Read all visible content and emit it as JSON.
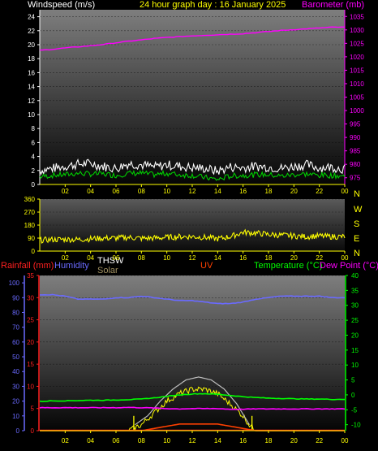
{
  "header": {
    "left_label": "Windspeed (m/s)",
    "title": "24 hour graph day : 16 January 2025",
    "right_label": "Barometer (mb)"
  },
  "colors": {
    "windspeed_axis": "#ffffff",
    "title": "#ffff00",
    "barometer": "#ff00ff",
    "wind_gust": "#ffffff",
    "wind_avg": "#00cc00",
    "wind_dir": "#ffff00",
    "rainfall": "#ff2020",
    "humidity": "#6a6aff",
    "thsw": "#ffffff",
    "solar": "#a09060",
    "uv": "#ff4000",
    "temperature": "#00ff00",
    "dew_point": "#ff00ff",
    "axis_grid_text": "#ffff00"
  },
  "chart_data": [
    {
      "type": "line",
      "xlabel": "",
      "x_ticks": [
        "02",
        "04",
        "06",
        "08",
        "10",
        "12",
        "14",
        "16",
        "18",
        "20",
        "22",
        "00"
      ],
      "left_axis": {
        "label": "Windspeed (m/s)",
        "ylim": [
          0,
          25
        ],
        "ticks": [
          0,
          2,
          4,
          6,
          8,
          10,
          12,
          14,
          16,
          18,
          20,
          22,
          24
        ]
      },
      "right_axis": {
        "label": "Barometer (mb)",
        "ylim": [
          972.5,
          1037.5
        ],
        "ticks": [
          975,
          980,
          985,
          990,
          995,
          1000,
          1005,
          1010,
          1015,
          1020,
          1025,
          1030,
          1035
        ]
      },
      "series": [
        {
          "name": "Barometer (mb)",
          "axis": "right",
          "x": [
            0,
            1,
            2,
            3,
            4,
            5,
            6,
            7,
            8,
            9,
            10,
            11,
            12,
            13,
            14,
            15,
            16,
            17,
            18,
            19,
            20,
            21,
            22,
            23,
            24
          ],
          "values": [
            1022.4,
            1022.8,
            1023.3,
            1023.7,
            1024.1,
            1024.6,
            1025.2,
            1025.8,
            1026.3,
            1026.8,
            1027.2,
            1027.5,
            1027.8,
            1028.0,
            1028.2,
            1028.4,
            1028.6,
            1029.0,
            1029.4,
            1029.8,
            1030.1,
            1030.4,
            1030.7,
            1031.0,
            1031.0
          ]
        },
        {
          "name": "Gust",
          "axis": "left",
          "x": [
            0,
            1,
            2,
            3,
            4,
            5,
            6,
            7,
            8,
            9,
            10,
            11,
            12,
            13,
            14,
            15,
            16,
            17,
            18,
            19,
            20,
            21,
            22,
            23,
            24
          ],
          "values": [
            2.0,
            2.3,
            2.6,
            2.9,
            3.0,
            2.6,
            2.3,
            3.0,
            2.8,
            2.5,
            2.8,
            2.6,
            2.4,
            2.3,
            1.9,
            2.5,
            2.4,
            2.6,
            2.5,
            2.3,
            2.6,
            2.8,
            2.4,
            2.5,
            2.2
          ]
        },
        {
          "name": "Average",
          "axis": "left",
          "x": [
            0,
            1,
            2,
            3,
            4,
            5,
            6,
            7,
            8,
            9,
            10,
            11,
            12,
            13,
            14,
            15,
            16,
            17,
            18,
            19,
            20,
            21,
            22,
            23,
            24
          ],
          "values": [
            1.1,
            1.3,
            1.4,
            1.6,
            1.5,
            1.5,
            1.3,
            1.6,
            1.6,
            1.4,
            1.6,
            1.4,
            1.3,
            1.0,
            0.7,
            1.2,
            1.3,
            1.4,
            1.4,
            1.2,
            1.4,
            1.5,
            1.3,
            1.3,
            1.2
          ]
        }
      ]
    },
    {
      "type": "line",
      "x_ticks": [
        "02",
        "04",
        "06",
        "08",
        "10",
        "12",
        "14",
        "16",
        "18",
        "20",
        "22",
        "00"
      ],
      "left_axis": {
        "label": "",
        "ylim": [
          0,
          360
        ],
        "ticks": [
          0,
          90,
          180,
          270,
          360
        ]
      },
      "right_axis": {
        "label": "",
        "ticks": [
          "N",
          "W",
          "S",
          "E",
          "N"
        ]
      },
      "series": [
        {
          "name": "Wind direction",
          "x": [
            0,
            1,
            2,
            3,
            4,
            5,
            6,
            7,
            8,
            9,
            10,
            11,
            12,
            13,
            14,
            15,
            16,
            17,
            18,
            19,
            20,
            21,
            22,
            23,
            24
          ],
          "values": [
            75,
            80,
            82,
            80,
            85,
            90,
            90,
            95,
            88,
            90,
            95,
            100,
            100,
            95,
            85,
            100,
            130,
            125,
            115,
            110,
            105,
            100,
            105,
            100,
            100
          ]
        }
      ]
    },
    {
      "type": "line",
      "x_ticks": [
        "02",
        "04",
        "06",
        "08",
        "10",
        "12",
        "14",
        "16",
        "18",
        "20",
        "22",
        "00"
      ],
      "labels": {
        "rainfall": "Rainfall (mm)",
        "humidity": "Humidity",
        "thsw": "THSW",
        "solar": "Solar",
        "uv": "UV",
        "temperature": "Temperature (°C)",
        "dew_point": "Dew Point (°C)"
      },
      "humidity_axis": {
        "ylim": [
          0,
          105
        ],
        "ticks": [
          0,
          10,
          20,
          30,
          40,
          50,
          60,
          70,
          80,
          90,
          100
        ]
      },
      "rain_axis": {
        "ylim": [
          0,
          35
        ],
        "ticks": [
          0,
          5,
          10,
          15,
          20,
          25,
          30,
          35
        ]
      },
      "temp_axis": {
        "ylim": [
          -12,
          40
        ],
        "ticks": [
          -10,
          -5,
          0,
          5,
          10,
          15,
          20,
          25,
          30,
          35,
          40
        ]
      },
      "series": [
        {
          "name": "Humidity",
          "axis": "humidity",
          "x": [
            0,
            1,
            2,
            3,
            4,
            5,
            6,
            7,
            8,
            9,
            10,
            11,
            12,
            13,
            14,
            15,
            16,
            17,
            18,
            19,
            20,
            21,
            22,
            23,
            24
          ],
          "values": [
            92,
            92,
            91,
            89,
            89,
            89,
            90,
            90,
            91,
            90,
            89,
            88,
            88,
            87,
            86,
            86,
            87,
            89,
            90,
            91,
            91,
            91,
            91,
            90,
            90
          ]
        },
        {
          "name": "Temperature",
          "axis": "temp",
          "x": [
            0,
            1,
            2,
            3,
            4,
            5,
            6,
            7,
            8,
            9,
            10,
            11,
            12,
            13,
            14,
            15,
            16,
            17,
            18,
            19,
            20,
            21,
            22,
            23,
            24
          ],
          "values": [
            -2.2,
            -2.0,
            -2.0,
            -1.9,
            -1.8,
            -1.8,
            -1.7,
            -1.6,
            -1.4,
            -1.0,
            -0.5,
            0.0,
            0.3,
            0.4,
            0.2,
            -0.2,
            -0.6,
            -0.9,
            -1.1,
            -1.2,
            -1.3,
            -1.4,
            -1.4,
            -1.5,
            -1.5
          ]
        },
        {
          "name": "Dew Point",
          "axis": "temp",
          "x": [
            0,
            1,
            2,
            3,
            4,
            5,
            6,
            7,
            8,
            9,
            10,
            11,
            12,
            13,
            14,
            15,
            16,
            17,
            18,
            19,
            20,
            21,
            22,
            23,
            24
          ],
          "values": [
            -4.3,
            -4.3,
            -4.3,
            -4.3,
            -4.3,
            -4.3,
            -4.3,
            -4.2,
            -4.3,
            -4.4,
            -4.6,
            -4.7,
            -4.6,
            -4.6,
            -4.6,
            -4.8,
            -4.8,
            -4.7,
            -4.7,
            -4.7,
            -4.7,
            -4.7,
            -4.7,
            -4.7,
            -4.7
          ]
        },
        {
          "name": "Solar",
          "axis": "humidity",
          "x": [
            0,
            7,
            8,
            9,
            10,
            11,
            12,
            13,
            14,
            15,
            16,
            16.5,
            17,
            24
          ],
          "values": [
            0,
            0,
            4,
            12,
            20,
            25,
            28,
            28,
            25,
            18,
            10,
            4,
            0,
            0
          ]
        },
        {
          "name": "THSW",
          "axis": "temp",
          "x": [
            7.5,
            8.5,
            9.5,
            10.5,
            11.5,
            12.5,
            13.5,
            14.5,
            15.5,
            16.5
          ],
          "values": [
            -10,
            -7,
            -2,
            2,
            5,
            6,
            5,
            2,
            -3,
            -10
          ]
        },
        {
          "name": "UV",
          "axis": "rain",
          "x": [
            0,
            8,
            9,
            10,
            11,
            12,
            13,
            14,
            15,
            16,
            17,
            24
          ],
          "values": [
            0,
            0,
            0.5,
            1,
            1.5,
            1.5,
            1.5,
            1.5,
            1,
            0.5,
            0,
            0
          ]
        }
      ]
    }
  ]
}
